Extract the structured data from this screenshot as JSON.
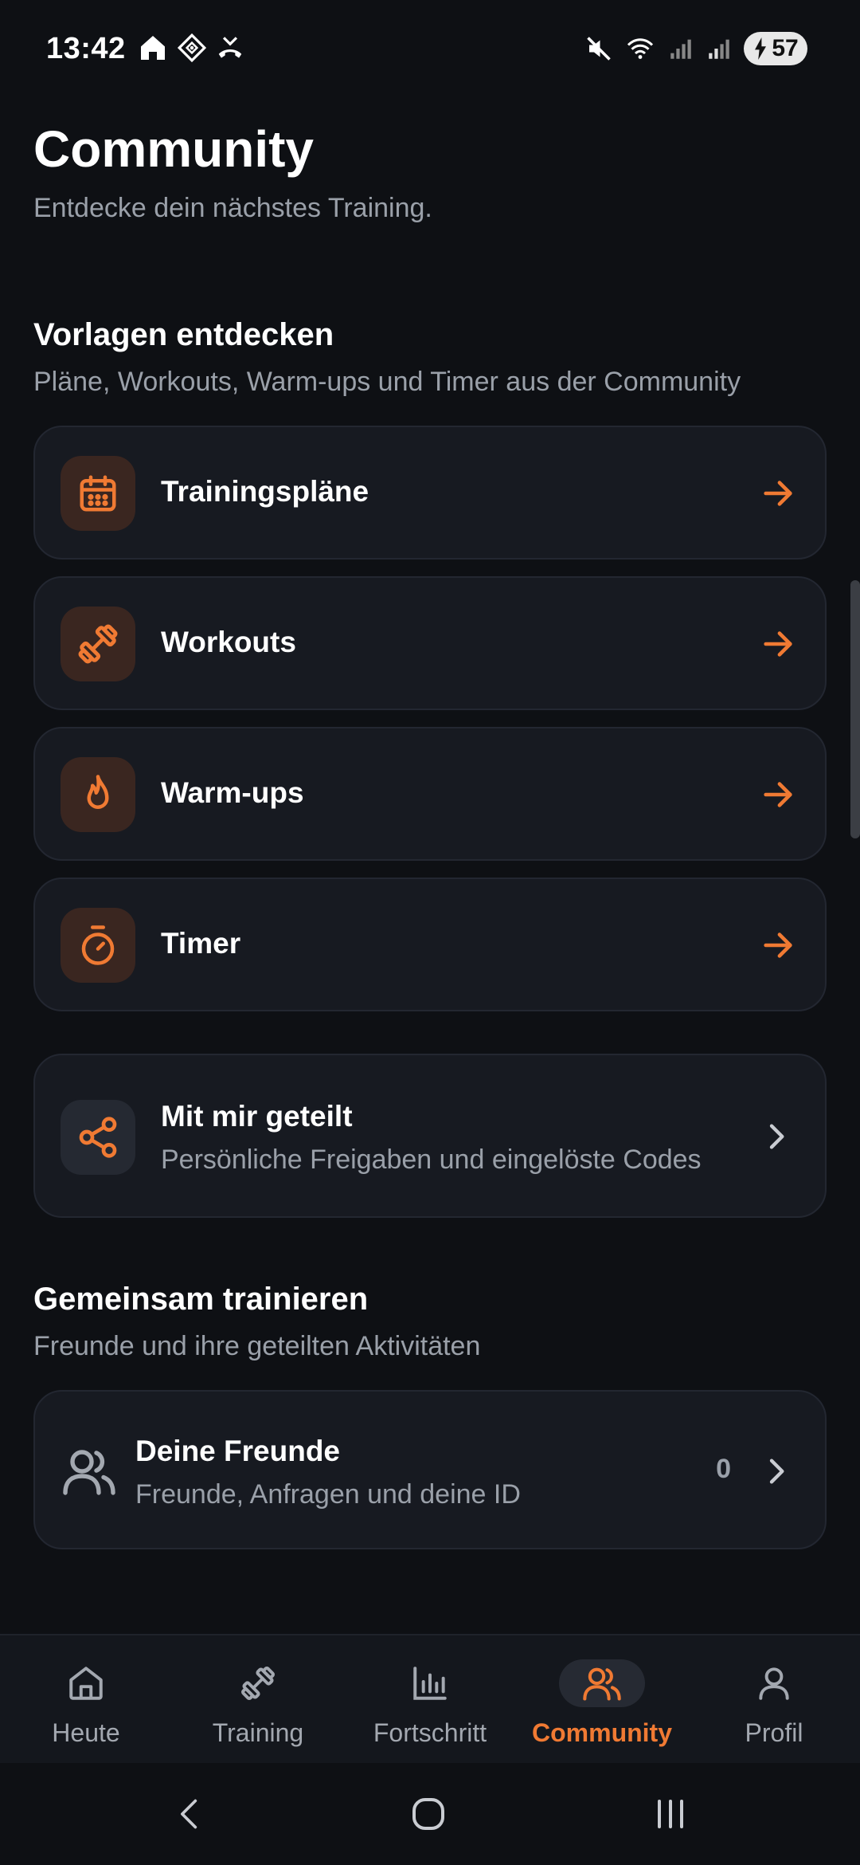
{
  "status_bar": {
    "time": "13:42",
    "battery": "57"
  },
  "header": {
    "title": "Community",
    "subtitle": "Entdecke dein nächstes Training."
  },
  "templates_section": {
    "title": "Vorlagen entdecken",
    "subtitle": "Pläne, Workouts, Warm-ups und Timer aus der Community",
    "items": [
      {
        "label": "Trainingspläne",
        "icon": "calendar-icon"
      },
      {
        "label": "Workouts",
        "icon": "dumbbell-icon"
      },
      {
        "label": "Warm-ups",
        "icon": "flame-icon"
      },
      {
        "label": "Timer",
        "icon": "stopwatch-icon"
      }
    ]
  },
  "shared": {
    "title": "Mit mir geteilt",
    "subtitle": "Persönliche Freigaben und eingelöste Codes",
    "icon": "share-icon"
  },
  "together_section": {
    "title": "Gemeinsam trainieren",
    "subtitle": "Freunde und ihre geteilten Aktivitäten"
  },
  "friends": {
    "title": "Deine Freunde",
    "subtitle": "Freunde, Anfragen und deine ID",
    "count": "0",
    "icon": "users-icon"
  },
  "bottom_nav": {
    "items": [
      {
        "label": "Heute",
        "icon": "home-icon"
      },
      {
        "label": "Training",
        "icon": "dumbbell-icon"
      },
      {
        "label": "Fortschritt",
        "icon": "bar-chart-icon"
      },
      {
        "label": "Community",
        "icon": "users-icon",
        "active": true
      },
      {
        "label": "Profil",
        "icon": "user-icon"
      }
    ]
  },
  "colors": {
    "accent": "#f07a33",
    "background": "#0e1014",
    "card": "#171a21",
    "muted_text": "#9aa0a9"
  }
}
